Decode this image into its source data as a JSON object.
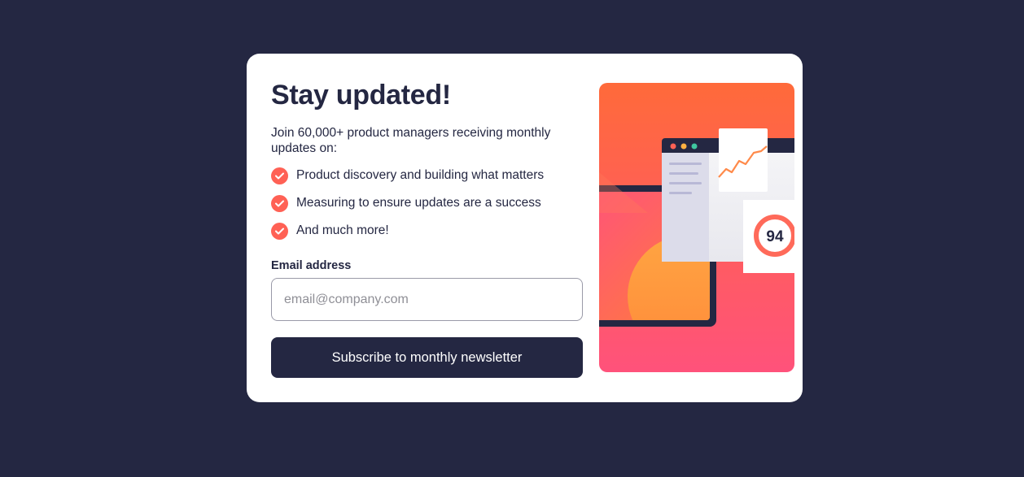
{
  "card": {
    "title": "Stay updated!",
    "intro": "Join 60,000+ product managers receiving monthly updates on:",
    "features": [
      "Product discovery and building what matters",
      "Measuring to ensure updates are a success",
      "And much more!"
    ],
    "email_label": "Email address",
    "email_placeholder": "email@company.com",
    "email_value": "",
    "subscribe_label": "Subscribe to monthly newsletter"
  },
  "illustration": {
    "score": "94"
  },
  "icons": {
    "feature_check": "check-icon"
  },
  "colors": {
    "background": "#242742",
    "accent": "#ff6155",
    "text": "#242742",
    "card": "#ffffff"
  }
}
